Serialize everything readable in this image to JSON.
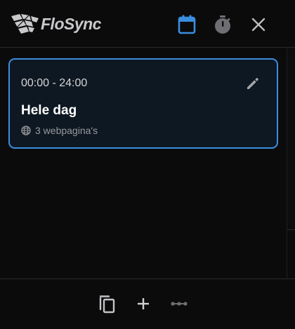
{
  "app": {
    "brand": "FloSync"
  },
  "header": {
    "icons": [
      "calendar-icon",
      "timer-icon",
      "close-icon"
    ],
    "active_icon": "calendar-icon",
    "accent_color": "#3a8ee0"
  },
  "schedule": {
    "items": [
      {
        "time_range": "00:00 - 24:00",
        "title": "Hele dag",
        "subtitle": "3 webpagina's",
        "selected": true
      }
    ]
  },
  "footer": {
    "icons": [
      "copy-icon",
      "plus-icon",
      "link-icon"
    ]
  },
  "colors": {
    "background": "#0b0b0c",
    "card_background": "#0e1822",
    "card_border": "#3a8ee0",
    "muted": "#9a9a9e"
  }
}
